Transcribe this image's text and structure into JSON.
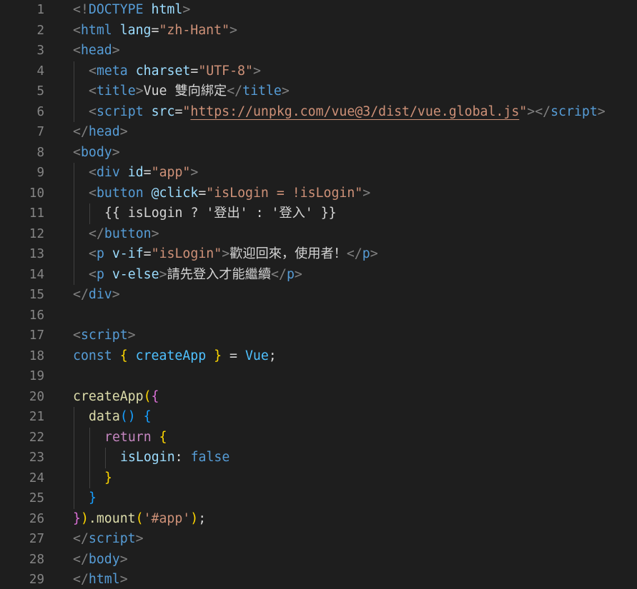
{
  "colors": {
    "background": "#1e1e1e",
    "line_number": "#858585",
    "tag_bracket": "#808080",
    "tag_name": "#569cd6",
    "attribute": "#9cdcfe",
    "string": "#ce9178",
    "text": "#d4d4d4",
    "keyword_control": "#c586c0",
    "function": "#dcdcaa",
    "brace_gold": "#ffd700",
    "brace_pink": "#da70d6",
    "brace_blue": "#179fff",
    "constant": "#4fc1ff",
    "boolean": "#569cd6"
  },
  "lines": [
    {
      "n": "1",
      "indent": 0,
      "tokens": [
        [
          "<!",
          "tb"
        ],
        [
          "DOCTYPE ",
          "tag"
        ],
        [
          "html",
          "attr"
        ],
        [
          ">",
          "tb"
        ]
      ]
    },
    {
      "n": "2",
      "indent": 0,
      "tokens": [
        [
          "<",
          "tb"
        ],
        [
          "html ",
          "tag"
        ],
        [
          "lang",
          "attr"
        ],
        [
          "=",
          "txt"
        ],
        [
          "\"zh-Hant\"",
          "str"
        ],
        [
          ">",
          "tb"
        ]
      ]
    },
    {
      "n": "3",
      "indent": 0,
      "tokens": [
        [
          "<",
          "tb"
        ],
        [
          "head",
          "tag"
        ],
        [
          ">",
          "tb"
        ]
      ]
    },
    {
      "n": "4",
      "indent": 1,
      "tokens": [
        [
          "<",
          "tb"
        ],
        [
          "meta ",
          "tag"
        ],
        [
          "charset",
          "attr"
        ],
        [
          "=",
          "txt"
        ],
        [
          "\"UTF-8\"",
          "str"
        ],
        [
          ">",
          "tb"
        ]
      ]
    },
    {
      "n": "5",
      "indent": 1,
      "tokens": [
        [
          "<",
          "tb"
        ],
        [
          "title",
          "tag"
        ],
        [
          ">",
          "tb"
        ],
        [
          "Vue 雙向綁定",
          "txt"
        ],
        [
          "</",
          "tb"
        ],
        [
          "title",
          "tag"
        ],
        [
          ">",
          "tb"
        ]
      ]
    },
    {
      "n": "6",
      "indent": 1,
      "tokens": [
        [
          "<",
          "tb"
        ],
        [
          "script ",
          "tag"
        ],
        [
          "src",
          "attr"
        ],
        [
          "=",
          "txt"
        ],
        [
          "\"",
          "str"
        ],
        [
          "https://unpkg.com/vue@3/dist/vue.global.js",
          "link"
        ],
        [
          "\"",
          "str"
        ],
        [
          ">",
          "tb"
        ],
        [
          "</",
          "tb"
        ],
        [
          "script",
          "tag"
        ],
        [
          ">",
          "tb"
        ]
      ]
    },
    {
      "n": "7",
      "indent": 0,
      "tokens": [
        [
          "</",
          "tb"
        ],
        [
          "head",
          "tag"
        ],
        [
          ">",
          "tb"
        ]
      ]
    },
    {
      "n": "8",
      "indent": 0,
      "tokens": [
        [
          "<",
          "tb"
        ],
        [
          "body",
          "tag"
        ],
        [
          ">",
          "tb"
        ]
      ]
    },
    {
      "n": "9",
      "indent": 1,
      "tokens": [
        [
          "<",
          "tb"
        ],
        [
          "div ",
          "tag"
        ],
        [
          "id",
          "attr"
        ],
        [
          "=",
          "txt"
        ],
        [
          "\"app\"",
          "str"
        ],
        [
          ">",
          "tb"
        ]
      ]
    },
    {
      "n": "10",
      "indent": 1,
      "tokens": [
        [
          "<",
          "tb"
        ],
        [
          "button ",
          "tag"
        ],
        [
          "@click",
          "attr"
        ],
        [
          "=",
          "txt"
        ],
        [
          "\"isLogin = !isLogin\"",
          "str"
        ],
        [
          ">",
          "tb"
        ]
      ]
    },
    {
      "n": "11",
      "indent": 2,
      "tokens": [
        [
          "{{ isLogin ? '登出' : '登入' }}",
          "txt"
        ]
      ]
    },
    {
      "n": "12",
      "indent": 1,
      "tokens": [
        [
          "</",
          "tb"
        ],
        [
          "button",
          "tag"
        ],
        [
          ">",
          "tb"
        ]
      ]
    },
    {
      "n": "13",
      "indent": 1,
      "tokens": [
        [
          "<",
          "tb"
        ],
        [
          "p ",
          "tag"
        ],
        [
          "v-if",
          "attr"
        ],
        [
          "=",
          "txt"
        ],
        [
          "\"isLogin\"",
          "str"
        ],
        [
          ">",
          "tb"
        ],
        [
          "歡迎回來，使用者！",
          "txt"
        ],
        [
          "</",
          "tb"
        ],
        [
          "p",
          "tag"
        ],
        [
          ">",
          "tb"
        ]
      ]
    },
    {
      "n": "14",
      "indent": 1,
      "tokens": [
        [
          "<",
          "tb"
        ],
        [
          "p ",
          "tag"
        ],
        [
          "v-else",
          "attr"
        ],
        [
          ">",
          "tb"
        ],
        [
          "請先登入才能繼續",
          "txt"
        ],
        [
          "</",
          "tb"
        ],
        [
          "p",
          "tag"
        ],
        [
          ">",
          "tb"
        ]
      ]
    },
    {
      "n": "15",
      "indent": 0,
      "tokens": [
        [
          "</",
          "tb"
        ],
        [
          "div",
          "tag"
        ],
        [
          ">",
          "tb"
        ]
      ]
    },
    {
      "n": "16",
      "indent": 0,
      "tokens": []
    },
    {
      "n": "17",
      "indent": 0,
      "tokens": [
        [
          "<",
          "tb"
        ],
        [
          "script",
          "tag"
        ],
        [
          ">",
          "tb"
        ]
      ]
    },
    {
      "n": "18",
      "indent": 0,
      "tokens": [
        [
          "const ",
          "kw"
        ],
        [
          "{ ",
          "gold"
        ],
        [
          "createApp",
          "const"
        ],
        [
          " }",
          "gold"
        ],
        [
          " = ",
          "txt"
        ],
        [
          "Vue",
          "const"
        ],
        [
          ";",
          "txt"
        ]
      ]
    },
    {
      "n": "19",
      "indent": 0,
      "tokens": []
    },
    {
      "n": "20",
      "indent": 0,
      "tokens": [
        [
          "createApp",
          "fn"
        ],
        [
          "(",
          "gold"
        ],
        [
          "{",
          "pink"
        ]
      ]
    },
    {
      "n": "21",
      "indent": 1,
      "tokens": [
        [
          "data",
          "fn"
        ],
        [
          "() ",
          "blue"
        ],
        [
          "{",
          "blue"
        ]
      ]
    },
    {
      "n": "22",
      "indent": 2,
      "tokens": [
        [
          "return ",
          "ctl"
        ],
        [
          "{",
          "gold"
        ]
      ]
    },
    {
      "n": "23",
      "indent": 3,
      "tokens": [
        [
          "isLogin",
          "attr"
        ],
        [
          ": ",
          "txt"
        ],
        [
          "false",
          "bool"
        ]
      ]
    },
    {
      "n": "24",
      "indent": 2,
      "tokens": [
        [
          "}",
          "gold"
        ]
      ]
    },
    {
      "n": "25",
      "indent": 1,
      "tokens": [
        [
          "}",
          "blue"
        ]
      ]
    },
    {
      "n": "26",
      "indent": 0,
      "tokens": [
        [
          "}",
          "pink"
        ],
        [
          ")",
          "gold"
        ],
        [
          ".mount",
          "fn"
        ],
        [
          "(",
          "gold"
        ],
        [
          "'#app'",
          "str"
        ],
        [
          ")",
          "gold"
        ],
        [
          ";",
          "txt"
        ]
      ]
    },
    {
      "n": "27",
      "indent": 0,
      "tokens": [
        [
          "</",
          "tb"
        ],
        [
          "script",
          "tag"
        ],
        [
          ">",
          "tb"
        ]
      ]
    },
    {
      "n": "28",
      "indent": 0,
      "tokens": [
        [
          "</",
          "tb"
        ],
        [
          "body",
          "tag"
        ],
        [
          ">",
          "tb"
        ]
      ]
    },
    {
      "n": "29",
      "indent": 0,
      "tokens": [
        [
          "</",
          "tb"
        ],
        [
          "html",
          "tag"
        ],
        [
          ">",
          "tb"
        ]
      ]
    }
  ]
}
